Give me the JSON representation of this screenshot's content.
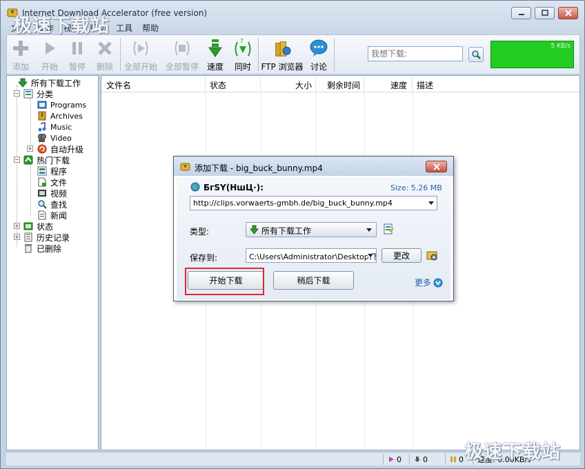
{
  "window": {
    "title": "Internet Download Accelerator (free version)",
    "menu": [
      "文件",
      "操作",
      "视图",
      "帮助",
      "工具",
      "帮助"
    ]
  },
  "toolbar": {
    "buttons": [
      {
        "label": "添加",
        "icon": "plus-icon",
        "enabled": false
      },
      {
        "label": "开始",
        "icon": "play-icon",
        "enabled": false
      },
      {
        "label": "暂停",
        "icon": "pause-icon",
        "enabled": false
      },
      {
        "label": "删除",
        "icon": "delete-x-icon",
        "enabled": false
      },
      {
        "label": "全部开始",
        "icon": "start-all-icon",
        "enabled": false
      },
      {
        "label": "全部暂停",
        "icon": "pause-all-icon",
        "enabled": false
      },
      {
        "label": "速度",
        "icon": "speed-arrow-icon",
        "enabled": true
      },
      {
        "label": "同时",
        "icon": "simultaneous-icon",
        "enabled": true
      },
      {
        "label": "FTP 浏览器",
        "icon": "ftp-browser-icon",
        "enabled": true
      },
      {
        "label": "讨论",
        "icon": "chat-bubble-icon",
        "enabled": true
      }
    ],
    "search_placeholder": "我想下载:",
    "speed_graph_label": "5 KB/s"
  },
  "sidebar": {
    "items": [
      {
        "label": "所有下载工作"
      },
      {
        "label": "分类"
      },
      {
        "label": "Programs"
      },
      {
        "label": "Archives"
      },
      {
        "label": "Music"
      },
      {
        "label": "Video"
      },
      {
        "label": "自动升级"
      },
      {
        "label": "热门下载"
      },
      {
        "label": "程序"
      },
      {
        "label": "文件"
      },
      {
        "label": "视频"
      },
      {
        "label": "查找"
      },
      {
        "label": "新闻"
      },
      {
        "label": "状态"
      },
      {
        "label": "历史记录"
      },
      {
        "label": "已删除"
      }
    ]
  },
  "list": {
    "columns": [
      "文件名",
      "状态",
      "大小",
      "剩余时间",
      "速度",
      "描述"
    ]
  },
  "statusbar": {
    "active": "0",
    "queued": "0",
    "paused": "0",
    "speed": "速度: 0.00KB/s"
  },
  "dialog": {
    "title": "添加下载 - big_buck_bunny.mp4",
    "name": "БгSY(НшЦ·):",
    "size": "Size: 5.26 MB",
    "url": "http://clips.vorwaerts-gmbh.de/big_buck_bunny.mp4",
    "type_label": "类型:",
    "category": "所有下载工作",
    "save_label": "保存到:",
    "save_path": "C:\\Users\\Administrator\\Desktop\\下载",
    "change_button": "更改",
    "start_button": "开始下载",
    "later_button": "稍后下载",
    "more_link": "更多"
  },
  "watermark": {
    "text": "极速下载站"
  }
}
